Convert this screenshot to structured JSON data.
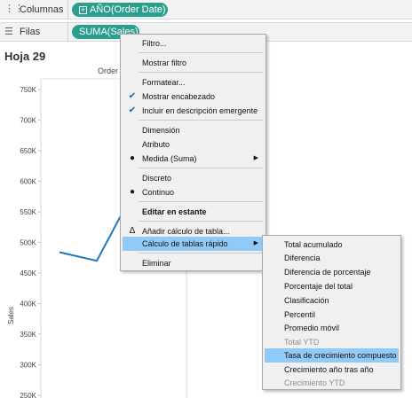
{
  "shelves": {
    "columns": {
      "label": "Columnas",
      "icon": "columns-icon",
      "pill": "AÑO(Order Date)"
    },
    "rows": {
      "label": "Filas",
      "icon": "rows-icon",
      "pill": "SUMA(Sales)"
    }
  },
  "sheet": {
    "title": "Hoja 29",
    "column_header": "Order D"
  },
  "colors": {
    "pill": "#2b9f8f",
    "line": "#1f78c1",
    "highlight": "#91c9f7",
    "check": "#1e63b4"
  },
  "menu": {
    "items": [
      {
        "label": "Filtro..."
      },
      {
        "label": "Mostrar filtro"
      },
      {
        "label": "Formatear..."
      },
      {
        "label": "Mostrar encabezado",
        "mark": "check"
      },
      {
        "label": "Incluir en descripción emergente",
        "mark": "check"
      },
      {
        "label": "Dimensión"
      },
      {
        "label": "Atributo"
      },
      {
        "label": "Medida (Suma)",
        "mark": "dot",
        "submenu": true
      },
      {
        "label": "Discreto"
      },
      {
        "label": "Continuo",
        "mark": "dot"
      },
      {
        "label": "Editar en estante",
        "bold": true
      },
      {
        "label": "Añadir cálculo de tabla...",
        "mark": "delta"
      },
      {
        "label": "Cálculo de tablas rápido",
        "submenu": true,
        "highlighted": true
      },
      {
        "label": "Eliminar"
      }
    ]
  },
  "submenu": {
    "items": [
      {
        "label": "Total acumulado"
      },
      {
        "label": "Diferencia"
      },
      {
        "label": "Diferencia de porcentaje"
      },
      {
        "label": "Porcentaje del total"
      },
      {
        "label": "Clasificación"
      },
      {
        "label": "Percentil"
      },
      {
        "label": "Promedio móvil"
      },
      {
        "label": "Total YTD",
        "disabled": true
      },
      {
        "label": "Tasa de crecimiento compuesto",
        "highlighted": true
      },
      {
        "label": "Crecimiento año tras año"
      },
      {
        "label": "Crecimiento YTD",
        "disabled": true
      }
    ]
  },
  "chart_data": {
    "type": "line",
    "ylabel": "Sales",
    "yticks": [
      "750K",
      "700K",
      "650K",
      "600K",
      "550K",
      "500K",
      "450K",
      "400K",
      "350K",
      "300K",
      "250K"
    ],
    "ylim": [
      250000,
      750000
    ],
    "series": [
      {
        "values": [
          484000,
          470000,
          560000
        ]
      }
    ]
  }
}
